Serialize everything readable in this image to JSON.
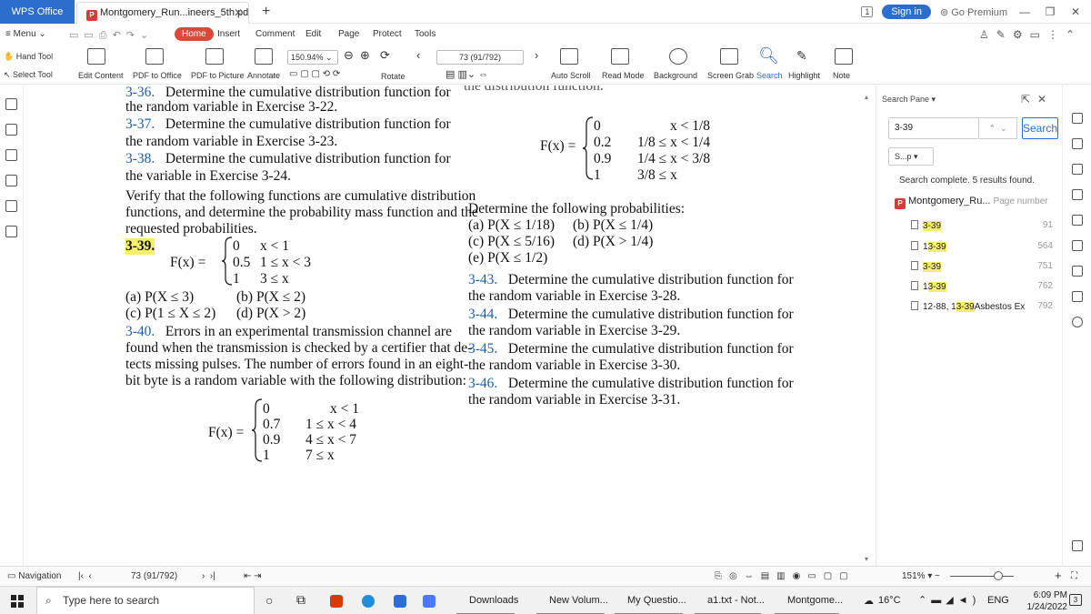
{
  "titlebar": {
    "app_tab": "WPS Office",
    "doc_tab": "Montgomery_Run...ineers_5th.pdf",
    "badge": "1",
    "sign_in": "Sign in",
    "premium": "Go Premium"
  },
  "menu": {
    "menu_label": "Menu",
    "tabs": [
      "Home",
      "Insert",
      "Comment",
      "Edit",
      "Page",
      "Protect",
      "Tools"
    ]
  },
  "ribbon": {
    "hand_tool": "Hand Tool",
    "select_tool": "Select Tool",
    "edit_content": "Edit Content",
    "pdf_to_office": "PDF to Office",
    "pdf_to_picture": "PDF to Picture",
    "annotate": "Annotate",
    "zoom": "150.94%",
    "rotate": "Rotate",
    "page": "73 (91/792)",
    "auto_scroll": "Auto Scroll",
    "read_mode": "Read Mode",
    "background": "Background",
    "screen_grab": "Screen Grab",
    "search": "Search",
    "highlight": "Highlight",
    "note": "Note"
  },
  "document": {
    "top_cut": "3-36.",
    "top_cut_text": "Determine the cumulative distribution function for",
    "l_the_random_22": "the random variable in Exercise 3-22.",
    "e337": "3-37.",
    "e337_text": "Determine the cumulative distribution function for",
    "l_the_random_23": "the random variable in Exercise 3-23.",
    "e338": "3-38.",
    "e338_text": "Determine the cumulative distribution function for",
    "l_the_variable_24": "the variable in Exercise 3-24.",
    "verify_1": "Verify that the following functions are cumulative distribution",
    "verify_2": "functions, and determine the probability mass function and the",
    "verify_3": "requested probabilities.",
    "e339": "3-39.",
    "f339_lhs": "F(x) =",
    "f339_vals": [
      "0",
      "0.5",
      "1"
    ],
    "f339_conds": [
      "x < 1",
      "1 ≤ x < 3",
      "3 ≤ x"
    ],
    "p339_a": "(a) P(X ≤ 3)",
    "p339_b": "(b) P(X ≤ 2)",
    "p339_c": "(c) P(1 ≤ X ≤ 2)",
    "p339_d": "(d) P(X > 2)",
    "e340": "3-40.",
    "e340_t1": "Errors in an experimental transmission channel are",
    "e340_t2": "found when the transmission is checked by a certifier that de-",
    "e340_t3": "tects missing pulses. The number of errors found in an eight-",
    "e340_t4": "bit byte is a random variable with the following distribution:",
    "f340_lhs": "F(x) =",
    "f340_vals": [
      "0",
      "0.7",
      "0.9",
      "1"
    ],
    "f340_conds": [
      "x < 1",
      "1 ≤ x < 4",
      "4 ≤ x < 7",
      "7 ≤ x"
    ],
    "rtop_cut": "the distribution function.",
    "f341_lhs": "F(x) =",
    "f341_vals": [
      "0",
      "0.2",
      "0.9",
      "1"
    ],
    "f341_conds": [
      "x < 1/8",
      "1/8 ≤ x < 1/4",
      "1/4 ≤ x < 3/8",
      "3/8 ≤ x"
    ],
    "det_follow": "Determine the following probabilities:",
    "p341_a": "(a) P(X ≤ 1/18)",
    "p341_b": "(b) P(X ≤ 1/4)",
    "p341_c": "(c) P(X ≤ 5/16)",
    "p341_d": "(d) P(X > 1/4)",
    "p341_e": "(e) P(X ≤ 1/2)",
    "e343": "3-43.",
    "e343_text": "Determine the cumulative distribution function for",
    "e343_l2": "the random variable in Exercise 3-28.",
    "e344": "3-44.",
    "e344_text": "Determine the cumulative distribution function for",
    "e344_l2": "the random variable in Exercise 3-29.",
    "e345": "3-45.",
    "e345_text": "Determine the cumulative distribution function for",
    "e345_l2": "the random variable in Exercise 3-30.",
    "e346": "3-46.",
    "e346_text": "Determine the cumulative distribution function for",
    "e346_l2": "the random variable in Exercise 3-31."
  },
  "search_pane": {
    "title": "Search Pane",
    "query": "3-39",
    "search_button": "Search",
    "scope": "S...p",
    "status": "Search complete. 5 results found.",
    "file": "Montgomery_Ru...",
    "page_number_label": "Page number",
    "results": [
      {
        "pre": "",
        "match": "3-39",
        "post": "",
        "page": "91"
      },
      {
        "pre": "1",
        "match": "3-39",
        "post": "",
        "page": "564"
      },
      {
        "pre": "",
        "match": "3-39",
        "post": "",
        "page": "751"
      },
      {
        "pre": "1",
        "match": "3-39",
        "post": "",
        "page": "762"
      },
      {
        "pre": "12-88, 1",
        "match": "3-39",
        "post": "Asbestos Ex",
        "page": "792"
      }
    ]
  },
  "statusbar": {
    "navigation": "Navigation",
    "page": "73 (91/792)",
    "zoom": "151%"
  },
  "taskbar": {
    "search_placeholder": "Type here to search",
    "items": [
      "Downloads",
      "New Volum...",
      "My Questio...",
      "a1.txt - Not...",
      "Montgome..."
    ],
    "weather": "16°C",
    "lang": "ENG",
    "time": "6:09 PM",
    "date": "1/24/2022",
    "notif_count": "3"
  }
}
